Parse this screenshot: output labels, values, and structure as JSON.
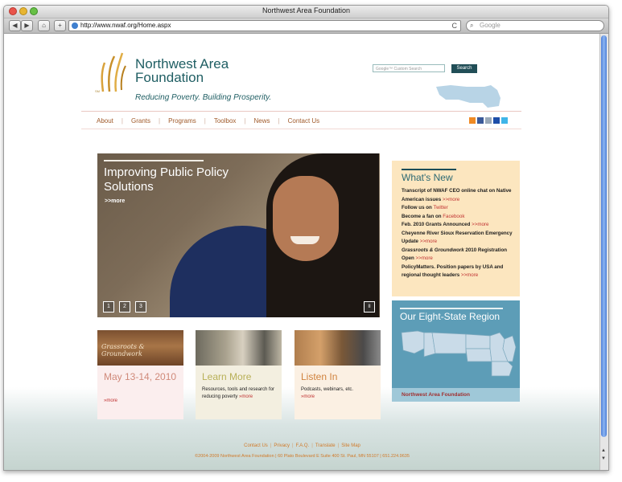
{
  "browser": {
    "window_title": "Northwest Area Foundation",
    "url": "http://www.nwaf.org/Home.aspx",
    "search_placeholder": "Google",
    "back_label": "◀",
    "forward_label": "▶",
    "home_label": "⌂",
    "add_label": "+",
    "reload_label": "C"
  },
  "header": {
    "logo_name": "Northwest Area Foundation",
    "logo_mark": "SM",
    "tagline": "Reducing Poverty. Building Prosperity.",
    "search_placeholder": "Google™ Custom Search",
    "search_button": "Search"
  },
  "nav": {
    "items": [
      "About",
      "Grants",
      "Programs",
      "Toolbox",
      "News",
      "Contact Us"
    ],
    "separator": "|"
  },
  "social": {
    "icons": [
      "rss-icon",
      "facebook-icon",
      "share-icon",
      "delicious-icon",
      "twitter-icon"
    ],
    "colors": [
      "#f08a24",
      "#3b5998",
      "#9aa8b8",
      "#1e4ea8",
      "#3fb5e8"
    ]
  },
  "hero": {
    "title": "Improving Public Policy Solutions",
    "more": ">>more",
    "slides": [
      "1",
      "2",
      "3"
    ],
    "pause": "II"
  },
  "whats_new": {
    "heading": "What's New",
    "items": [
      {
        "text": "Transcript of NWAF CEO online chat on Native American issues ",
        "link": ">>more"
      },
      {
        "text": "Follow us on ",
        "link": "Twitter"
      },
      {
        "text": "Become a fan on ",
        "link": "Facebook"
      },
      {
        "text": "Feb. 2010 Grants Announced ",
        "link": ">>more"
      },
      {
        "text": "Cheyenne River Sioux Reservation Emergency Update ",
        "link": ">>more"
      },
      {
        "text_italic": "Grassroots & Groundwork",
        "text": " 2010 Registration Open ",
        "link": ">>more"
      },
      {
        "text": "PolicyMatters.  Position papers by USA and regional thought leaders ",
        "link": ">>more"
      }
    ]
  },
  "region": {
    "heading": "Our Eight-State Region",
    "caption": "Northwest Area Foundation"
  },
  "cards": [
    {
      "image_text": "Grassroots & Groundwork",
      "title": "May 13-14, 2010",
      "text": "",
      "link": "»more"
    },
    {
      "image_text": "",
      "title": "Learn More",
      "text": "Resources, tools and research for reducing poverty ",
      "link": "»more"
    },
    {
      "image_text": "",
      "title": "Listen In",
      "text": "Podcasts, webinars, etc. ",
      "link": "»more"
    }
  ],
  "footer": {
    "links": [
      "Contact Us",
      "Privacy",
      "F.A.Q.",
      "Translate",
      "Site Map"
    ],
    "copyright": "©2004-2009 Northwest Area Foundation | 60 Plato Boulevard E Suite 400 St. Paul, MN 55107 | 651.224.9635"
  }
}
